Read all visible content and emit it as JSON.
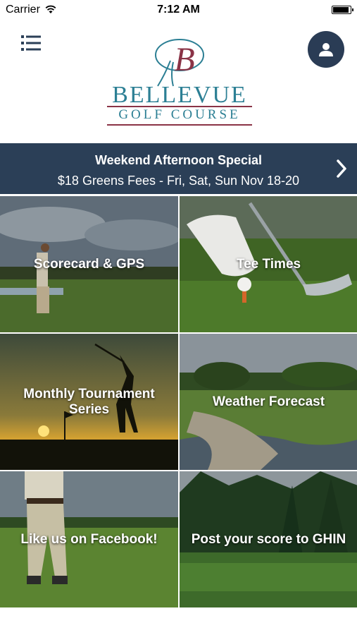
{
  "status_bar": {
    "carrier": "Carrier",
    "time": "7:12 AM",
    "battery_level": 1.0
  },
  "header": {
    "logo": {
      "monogram": "B",
      "name": "BELLEVUE",
      "subtitle": "GOLF COURSE"
    },
    "menu_icon": "hamburger-list-icon",
    "profile_icon": "user-icon"
  },
  "promo": {
    "title": "Weekend Afternoon Special",
    "details": "$18 Greens Fees - Fri, Sat, Sun Nov 18-20",
    "icon": "chevron-right-icon"
  },
  "tiles": [
    {
      "label": "Scorecard & GPS"
    },
    {
      "label": "Tee Times"
    },
    {
      "label": "Monthly Tournament Series"
    },
    {
      "label": "Weather Forecast"
    },
    {
      "label": "Like us on Facebook!"
    },
    {
      "label": "Post your score to GHIN"
    }
  ],
  "colors": {
    "navy": "#2b3f57",
    "teal": "#2c7f94",
    "maroon": "#8a3346"
  }
}
